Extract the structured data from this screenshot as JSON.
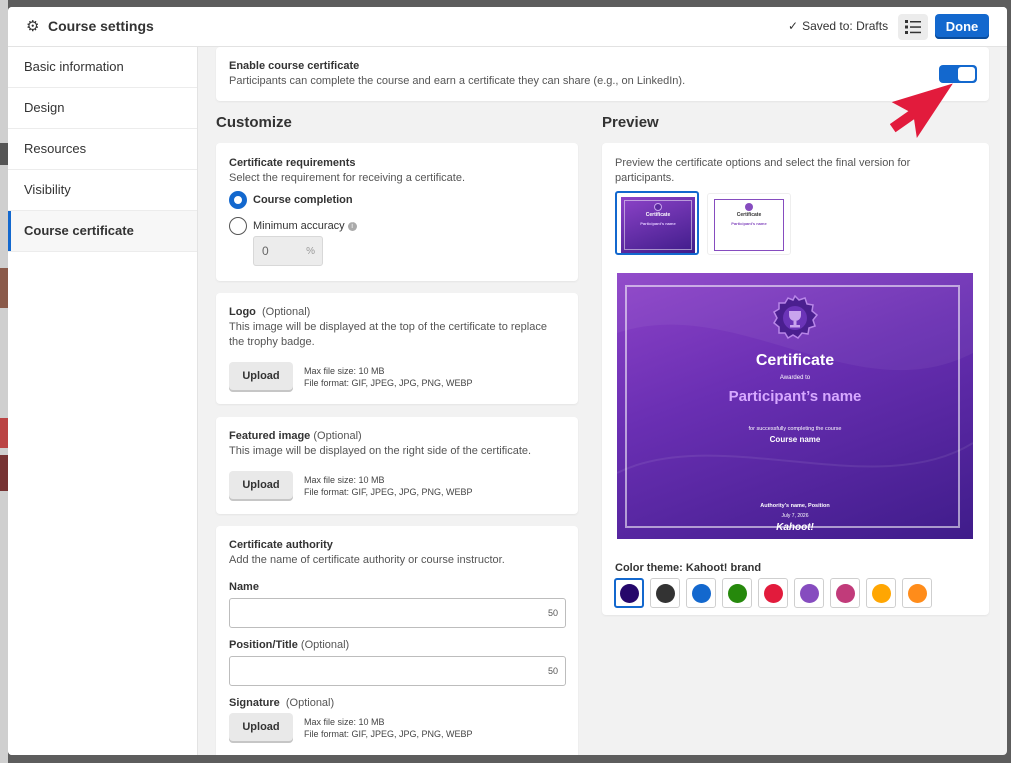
{
  "header": {
    "title": "Course settings",
    "saved_text": "Saved to: Drafts",
    "done_label": "Done"
  },
  "sidebar": {
    "items": [
      {
        "label": "Basic information"
      },
      {
        "label": "Design"
      },
      {
        "label": "Resources"
      },
      {
        "label": "Visibility"
      },
      {
        "label": "Course certificate",
        "active": true
      }
    ]
  },
  "enable": {
    "title": "Enable course certificate",
    "description": "Participants can complete the course and earn a certificate they can share (e.g., on LinkedIn).",
    "enabled": true
  },
  "customize": {
    "title": "Customize",
    "requirements": {
      "title": "Certificate requirements",
      "description": "Select the requirement for receiving a certificate.",
      "option_completion": "Course completion",
      "option_accuracy": "Minimum accuracy",
      "selected": "Course completion",
      "accuracy_value": "0",
      "accuracy_unit": "%"
    },
    "logo": {
      "title": "Logo",
      "optional": "(Optional)",
      "description": "This image will be displayed at the top of the certificate to replace the trophy badge.",
      "upload_label": "Upload",
      "max_size": "Max file size: 10 MB",
      "formats": "File format: GIF, JPEG, JPG, PNG, WEBP"
    },
    "featured": {
      "title": "Featured image",
      "optional": "(Optional)",
      "description": "This image will be displayed on the right side of the certificate.",
      "upload_label": "Upload",
      "max_size": "Max file size: 10 MB",
      "formats": "File format: GIF, JPEG, JPG, PNG, WEBP"
    },
    "authority": {
      "title": "Certificate authority",
      "description": "Add the name of certificate authority or course instructor.",
      "name_label": "Name",
      "name_counter": "50",
      "position_label": "Position/Title",
      "position_optional": "(Optional)",
      "position_counter": "50",
      "signature_label": "Signature",
      "signature_optional": "(Optional)",
      "upload_label": "Upload",
      "max_size": "Max file size: 10 MB",
      "formats": "File format: GIF, JPEG, JPG, PNG, WEBP"
    }
  },
  "preview": {
    "title": "Preview",
    "description": "Preview the certificate options and select the final version for participants.",
    "thumb1": {
      "title": "Certificate",
      "name": "Participant's name"
    },
    "thumb2": {
      "title": "Certificate",
      "name": "Participant's name"
    },
    "certificate": {
      "title": "Certificate",
      "awarded_to": "Awarded to",
      "participant": "Participant’s name",
      "for_text": "for successfully completing the course",
      "course_name": "Course name",
      "authority": "Authority's name, Position",
      "date": "July 7, 2026",
      "brand": "Kahoot!"
    },
    "color_theme_label": "Color theme: Kahoot! brand",
    "colors": [
      "#25076b",
      "#333333",
      "#1368ce",
      "#26890c",
      "#e21b3c",
      "#864cbf",
      "#c13b7a",
      "#ffa602",
      "#ff8c1a"
    ],
    "selected_color": "#25076b"
  },
  "colors": {
    "accent": "#1368ce",
    "arrow": "#e21b3c"
  }
}
